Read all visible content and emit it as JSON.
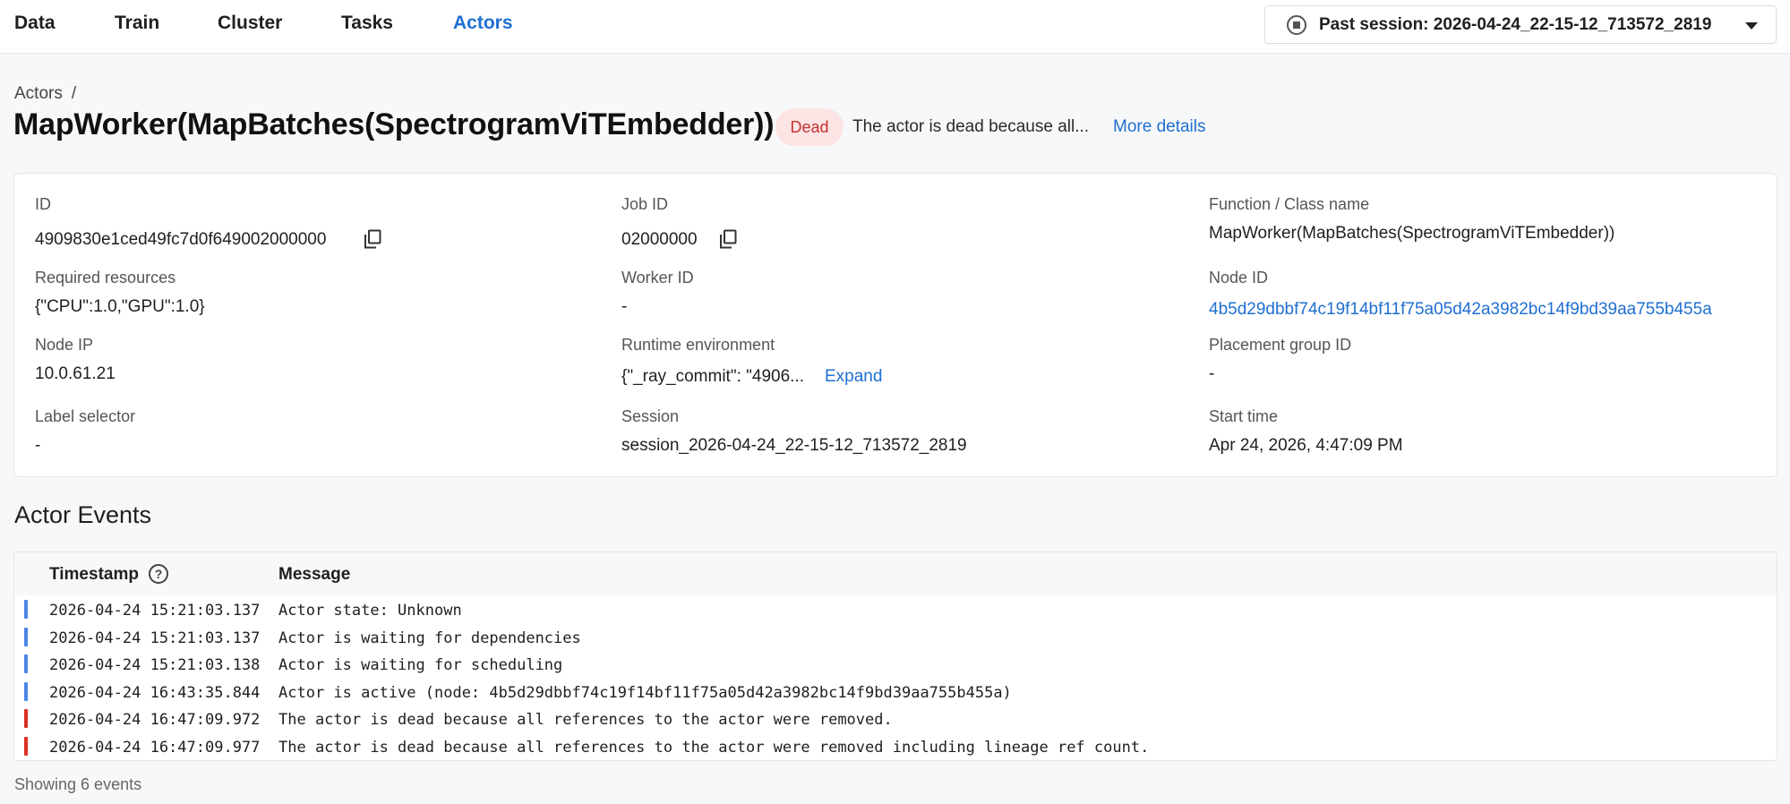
{
  "nav": {
    "items": [
      {
        "label": "Data",
        "active": false
      },
      {
        "label": "Train",
        "active": false
      },
      {
        "label": "Cluster",
        "active": false
      },
      {
        "label": "Tasks",
        "active": false
      },
      {
        "label": "Actors",
        "active": true
      }
    ],
    "session_label": "Past session: 2026-04-24_22-15-12_713572_2819"
  },
  "header": {
    "breadcrumb_root": "Actors",
    "breadcrumb_sep": "/",
    "title": "MapWorker(MapBatches(SpectrogramViTEmbedder))",
    "status": "Dead",
    "status_message": "The actor is dead because all...",
    "more_details": "More details"
  },
  "details": {
    "id_label": "ID",
    "id_value": "4909830e1ced49fc7d0f649002000000",
    "job_id_label": "Job ID",
    "job_id_value": "02000000",
    "function_label": "Function / Class name",
    "function_value": "MapWorker(MapBatches(SpectrogramViTEmbedder))",
    "resources_label": "Required resources",
    "resources_value": "{\"CPU\":1.0,\"GPU\":1.0}",
    "worker_id_label": "Worker ID",
    "worker_id_value": "-",
    "node_id_label": "Node ID",
    "node_id_value": "4b5d29dbbf74c19f14bf11f75a05d42a3982bc14f9bd39aa755b455a",
    "node_ip_label": "Node IP",
    "node_ip_value": "10.0.61.21",
    "runtime_env_label": "Runtime environment",
    "runtime_env_value": "{\"_ray_commit\": \"4906...",
    "expand_label": "Expand",
    "placement_group_label": "Placement group ID",
    "placement_group_value": "-",
    "label_selector_label": "Label selector",
    "label_selector_value": "-",
    "session_label": "Session",
    "session_value": "session_2026-04-24_22-15-12_713572_2819",
    "start_time_label": "Start time",
    "start_time_value": "Apr 24, 2026, 4:47:09 PM"
  },
  "events": {
    "title": "Actor Events",
    "col_timestamp": "Timestamp",
    "col_message": "Message",
    "help_glyph": "?",
    "colors": {
      "info": "#4a86e8",
      "error": "#d93025"
    },
    "rows": [
      {
        "timestamp": "2026-04-24 15:21:03.137",
        "message": "Actor state: Unknown",
        "level": "info"
      },
      {
        "timestamp": "2026-04-24 15:21:03.137",
        "message": "Actor is waiting for dependencies",
        "level": "info"
      },
      {
        "timestamp": "2026-04-24 15:21:03.138",
        "message": "Actor is waiting for scheduling",
        "level": "info"
      },
      {
        "timestamp": "2026-04-24 16:43:35.844",
        "message": "Actor is active (node: 4b5d29dbbf74c19f14bf11f75a05d42a3982bc14f9bd39aa755b455a)",
        "level": "info"
      },
      {
        "timestamp": "2026-04-24 16:47:09.972",
        "message": "The actor is dead because all references to the actor were removed.",
        "level": "error"
      },
      {
        "timestamp": "2026-04-24 16:47:09.977",
        "message": "The actor is dead because all references to the actor were removed including lineage ref count.",
        "level": "error"
      }
    ],
    "footer": "Showing 6 events"
  }
}
